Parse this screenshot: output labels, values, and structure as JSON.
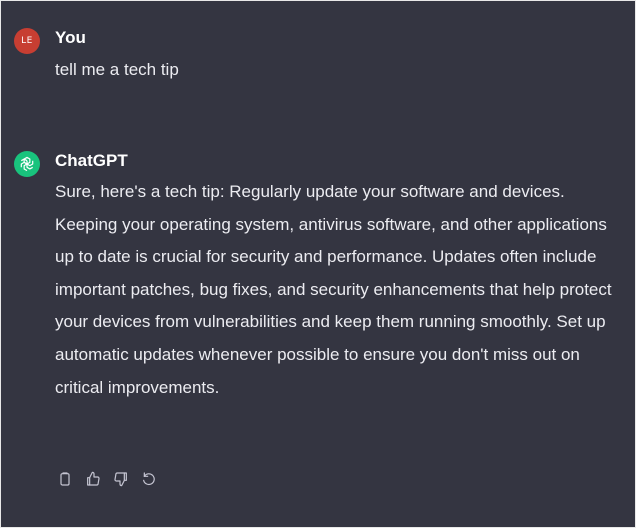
{
  "user_message": {
    "avatar_initials": "LE",
    "author": "You",
    "text": "tell me a tech tip"
  },
  "assistant_message": {
    "author": "ChatGPT",
    "avatar_icon": "openai-logo-icon",
    "text": "Sure, here's a tech tip: Regularly update your software and devices. Keeping your operating system, antivirus software, and other applications up to date is crucial for security and performance. Updates often include important patches, bug fixes, and security enhancements that help protect your devices from vulnerabilities and keep them running smoothly. Set up automatic updates whenever possible to ensure you don't miss out on critical improvements."
  },
  "actions": [
    {
      "icon": "copy-icon"
    },
    {
      "icon": "thumbs-up-icon"
    },
    {
      "icon": "thumbs-down-icon"
    },
    {
      "icon": "regenerate-icon"
    }
  ],
  "colors": {
    "background": "#343541",
    "user_avatar": "#c73e32",
    "assistant_avatar": "#19c37d",
    "text": "#ececf1"
  }
}
